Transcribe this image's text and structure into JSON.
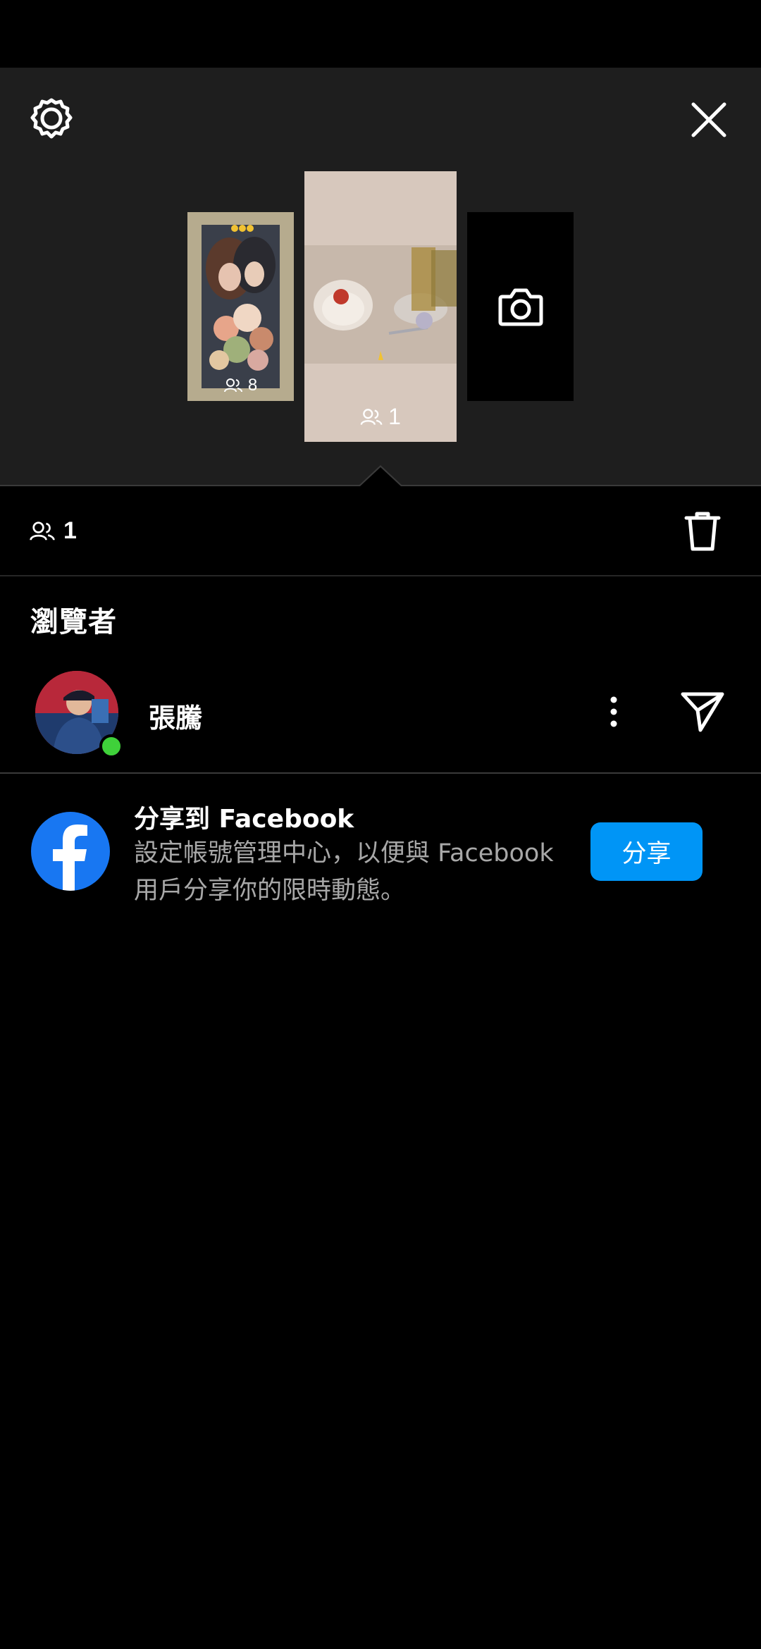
{
  "header": {
    "settings_icon": "gear-icon",
    "close_icon": "close-icon"
  },
  "stories": [
    {
      "viewer_count": "8"
    },
    {
      "viewer_count": "1"
    },
    {
      "camera_icon": "camera-icon"
    }
  ],
  "summary": {
    "viewer_count": "1",
    "delete_icon": "trash-icon"
  },
  "viewers_section": {
    "title": "瀏覽者",
    "viewers": [
      {
        "name": "張騰",
        "online": true
      }
    ]
  },
  "facebook_share": {
    "title": "分享到 Facebook",
    "description": "設定帳號管理中心，以便與 Facebook 用戶分享你的限時動態。",
    "button_label": "分享"
  },
  "colors": {
    "accent": "#0095f6",
    "facebook": "#1877f2",
    "online": "#3fd13a",
    "panel": "#1e1e1e"
  }
}
